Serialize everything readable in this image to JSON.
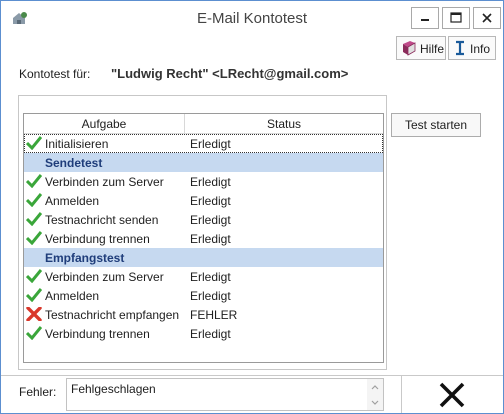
{
  "window": {
    "title": "E-Mail Kontotest"
  },
  "toolbar": {
    "help_label": "Hilfe",
    "info_label": "Info"
  },
  "account": {
    "label": "Kontotest für:",
    "value": "\"Ludwig Recht\" <LRecht@gmail.com>"
  },
  "grid": {
    "col_task": "Aufgabe",
    "col_status": "Status",
    "init": {
      "task": "Initialisieren",
      "status": "Erledigt",
      "icon": "check-icon"
    },
    "send_group": "Sendetest",
    "send": [
      {
        "task": "Verbinden zum Server",
        "status": "Erledigt",
        "icon": "check-icon"
      },
      {
        "task": "Anmelden",
        "status": "Erledigt",
        "icon": "check-icon"
      },
      {
        "task": "Testnachricht senden",
        "status": "Erledigt",
        "icon": "check-icon"
      },
      {
        "task": "Verbindung trennen",
        "status": "Erledigt",
        "icon": "check-icon"
      }
    ],
    "recv_group": "Empfangstest",
    "recv": [
      {
        "task": "Verbinden zum Server",
        "status": "Erledigt",
        "icon": "check-icon"
      },
      {
        "task": "Anmelden",
        "status": "Erledigt",
        "icon": "check-icon"
      },
      {
        "task": "Testnachricht empfangen",
        "status": "FEHLER",
        "icon": "error-x-icon"
      },
      {
        "task": "Verbindung trennen",
        "status": "Erledigt",
        "icon": "check-icon"
      }
    ]
  },
  "actions": {
    "start_label": "Test starten"
  },
  "error": {
    "label": "Fehler:",
    "value": "Fehlgeschlagen"
  },
  "colors": {
    "group_bg": "#c6d9f0",
    "group_text": "#1f3d7a",
    "check": "#3aa63a",
    "error": "#d9382b",
    "window_border": "#5c8fd0"
  }
}
